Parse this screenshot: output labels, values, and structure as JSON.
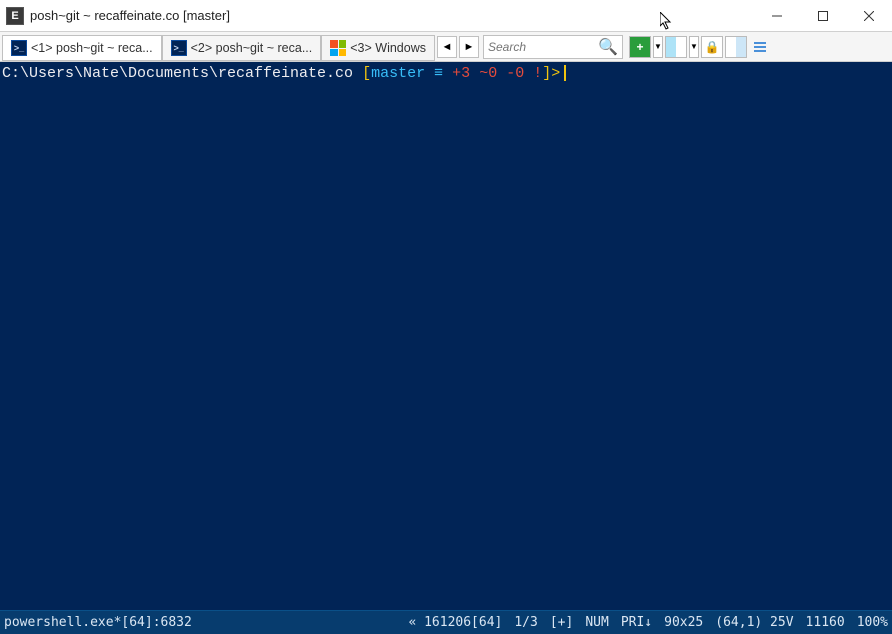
{
  "window": {
    "title": "posh~git ~ recaffeinate.co [master]"
  },
  "tabs": [
    {
      "label": "<1> posh~git ~ reca...",
      "icon": "ps"
    },
    {
      "label": "<2> posh~git ~ reca...",
      "icon": "ps"
    },
    {
      "label": "<3> Windows",
      "icon": "win"
    }
  ],
  "search": {
    "placeholder": "Search"
  },
  "prompt": {
    "path": "C:\\Users\\Nate\\Documents\\recaffeinate.co",
    "branch_open": "[",
    "branch": "master",
    "equiv": "≡",
    "added": "+3",
    "modified": "~0",
    "deleted": "-0",
    "bang": "!",
    "branch_close": "]>",
    "space": " "
  },
  "status": {
    "process": "powershell.exe*[64]:6832",
    "build": "« 161206[64]",
    "page": "1/3",
    "plus": "[+]",
    "num": "NUM",
    "pri": "PRI↓",
    "size": "90x25",
    "cursor": "(64,1) 25V",
    "mem": "11160",
    "zoom": "100%"
  }
}
